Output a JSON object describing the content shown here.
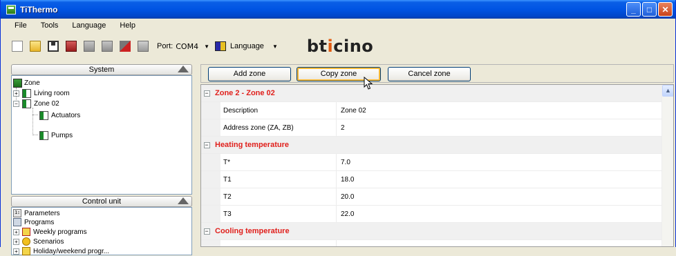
{
  "window": {
    "title": "TiThermo"
  },
  "menu": [
    "File",
    "Tools",
    "Language",
    "Help"
  ],
  "toolbar": {
    "port_label": "Port:",
    "port_value": "COM4",
    "language_label": "Language",
    "brand": "bticino"
  },
  "left": {
    "system_header": "System",
    "system_tree": {
      "root": "Zone",
      "items": [
        "Living room",
        "Zone 02",
        "Actuators",
        "Pumps"
      ]
    },
    "control_header": "Control unit",
    "control_tree": {
      "items": [
        "Parameters",
        "Programs",
        "Weekly programs",
        "Scenarios",
        "Holiday/weekend progr..."
      ]
    }
  },
  "right": {
    "buttons": {
      "add": "Add zone",
      "copy": "Copy zone",
      "cancel": "Cancel zone"
    },
    "grid": {
      "categories": [
        {
          "title": "Zone 2 - Zone 02",
          "rows": [
            {
              "name": "Description",
              "value": "Zone 02"
            },
            {
              "name": "Address zone (ZA, ZB)",
              "value": "2"
            }
          ]
        },
        {
          "title": "Heating temperature",
          "rows": [
            {
              "name": "T*",
              "value": "7.0"
            },
            {
              "name": "T1",
              "value": "18.0"
            },
            {
              "name": "T2",
              "value": "20.0"
            },
            {
              "name": "T3",
              "value": "22.0"
            }
          ]
        },
        {
          "title": "Cooling temperature",
          "rows": []
        }
      ]
    }
  }
}
